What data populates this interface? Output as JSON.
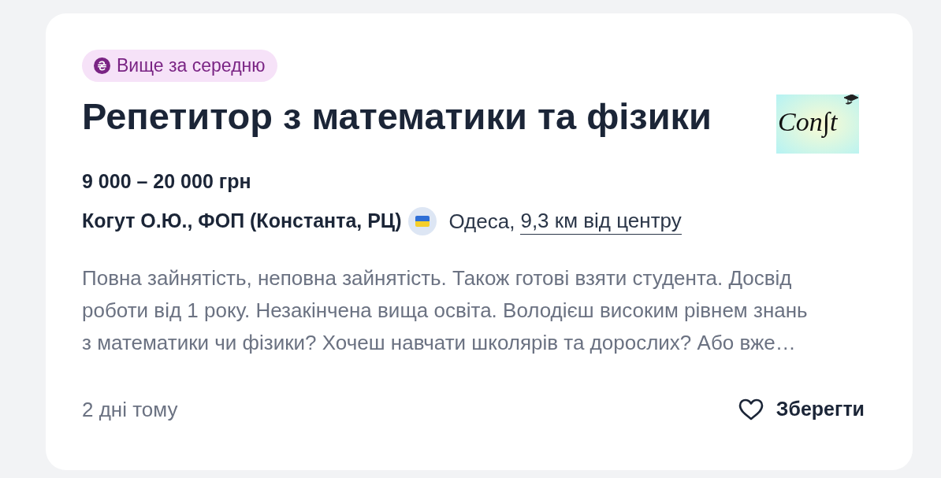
{
  "badge": {
    "label": "Вище за середню"
  },
  "title": "Репетитор з математики та фізики",
  "logo": {
    "text": "Con∫t"
  },
  "salary": "9 000 – 20 000 грн",
  "company": {
    "name": "Когут О.Ю., ФОП (Константа, РЦ)"
  },
  "location": {
    "city": "Одеса,",
    "distance": "9,3 км від центру"
  },
  "description_lines": [
    "Повна зайнятість, неповна зайнятість. Також готові взяти студента. Досвід",
    "роботи від 1 року. Незакінчена вища освіта. Володієш високим рівнем знань",
    "з математики чи фізики? Хочеш навчати школярів та дорослих? Або вже…"
  ],
  "posted": "2 дні тому",
  "save_button": {
    "label": "Зберегти",
    "saved": false
  }
}
